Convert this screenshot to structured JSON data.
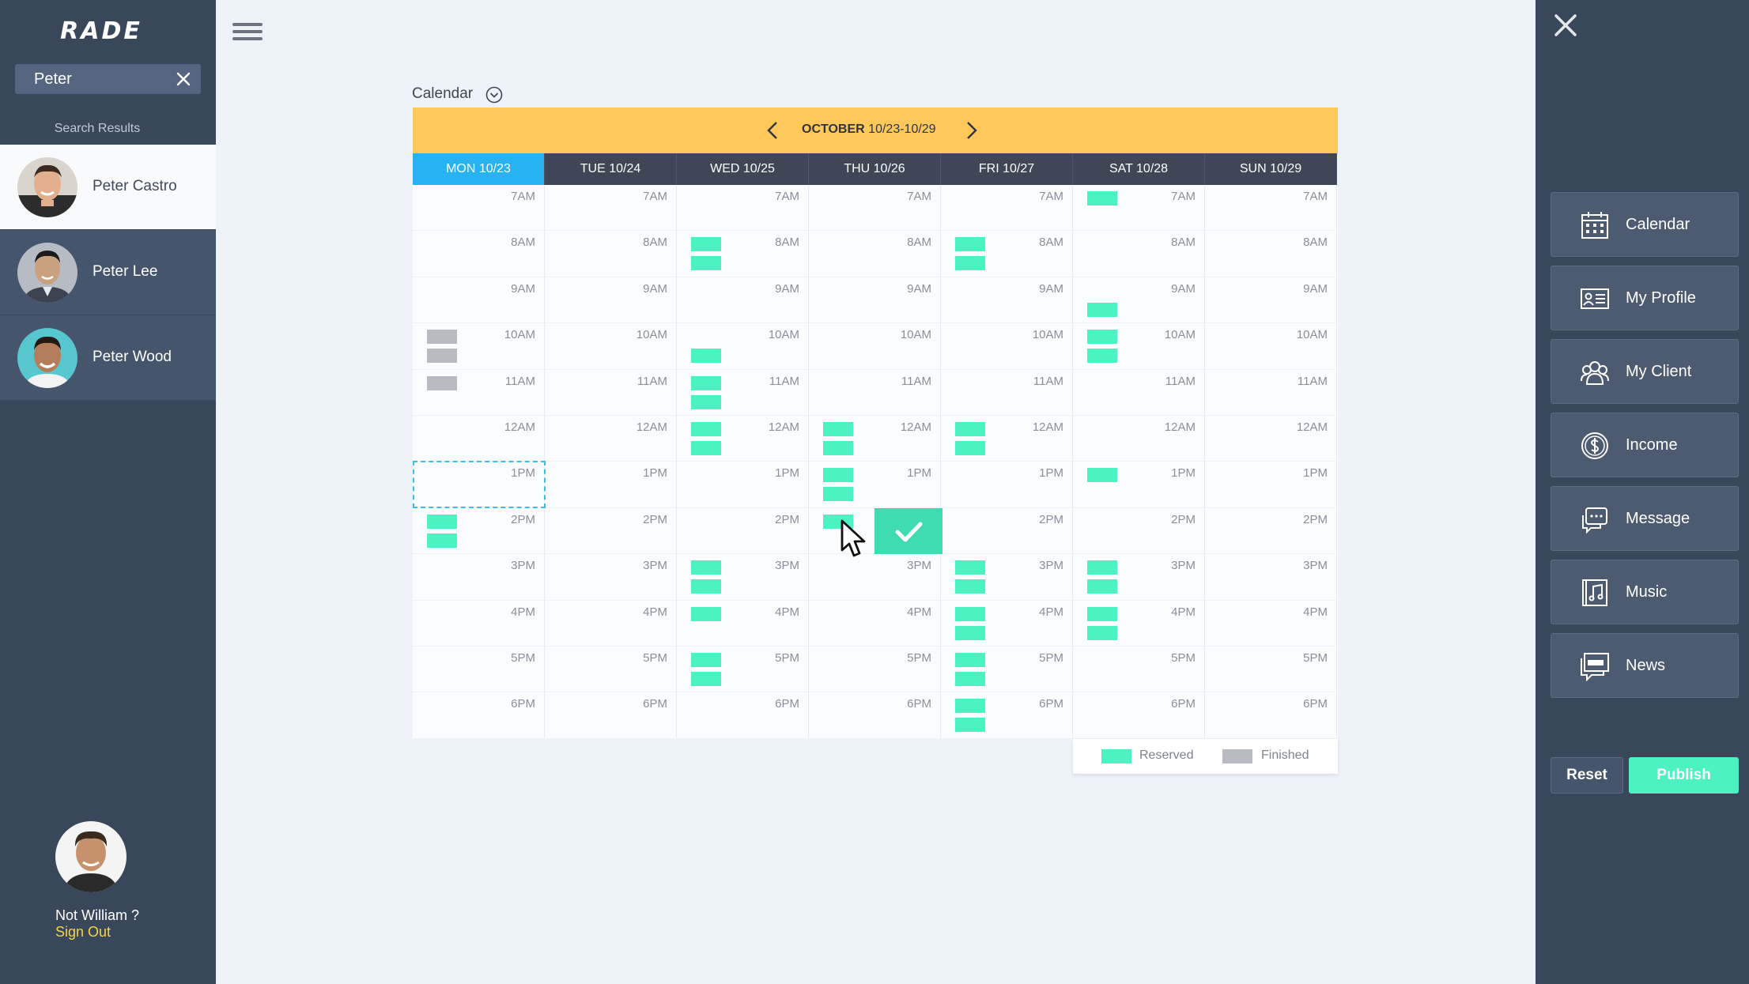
{
  "app": {
    "logo": "RADE"
  },
  "search": {
    "value": "Peter",
    "results_label": "Search Results"
  },
  "people": [
    {
      "name": "Peter Castro"
    },
    {
      "name": "Peter Lee"
    },
    {
      "name": "Peter Wood"
    }
  ],
  "account": {
    "not_user": "Not William ?",
    "sign_out": "Sign Out"
  },
  "calendar": {
    "label": "Calendar",
    "month": "OCTOBER",
    "range": "10/23-10/29",
    "days": [
      "MON  10/23",
      "TUE  10/24",
      "WED  10/25",
      "THU  10/26",
      "FRI  10/27",
      "SAT  10/28",
      "SUN  10/29"
    ],
    "selected_day": 0,
    "times": [
      "7AM",
      "8AM",
      "9AM",
      "10AM",
      "11AM",
      "12AM",
      "1PM",
      "2PM",
      "3PM",
      "4PM",
      "5PM",
      "6PM"
    ],
    "legend": {
      "reserved": "Reserved",
      "finished": "Finished"
    },
    "colors": {
      "reserved": "#4cf2c1",
      "finished": "#b8bcc2",
      "banner": "#fec85b",
      "selected_day": "#27b2f1"
    }
  },
  "menu": [
    {
      "label": "Calendar",
      "icon": "calendar-icon"
    },
    {
      "label": "My Profile",
      "icon": "profile-card-icon"
    },
    {
      "label": "My Client",
      "icon": "clients-icon"
    },
    {
      "label": "Income",
      "icon": "dollar-icon"
    },
    {
      "label": "Message",
      "icon": "message-icon"
    },
    {
      "label": "Music",
      "icon": "music-icon"
    },
    {
      "label": "News",
      "icon": "news-icon"
    }
  ],
  "actions": {
    "reset": "Reset",
    "publish": "Publish"
  }
}
